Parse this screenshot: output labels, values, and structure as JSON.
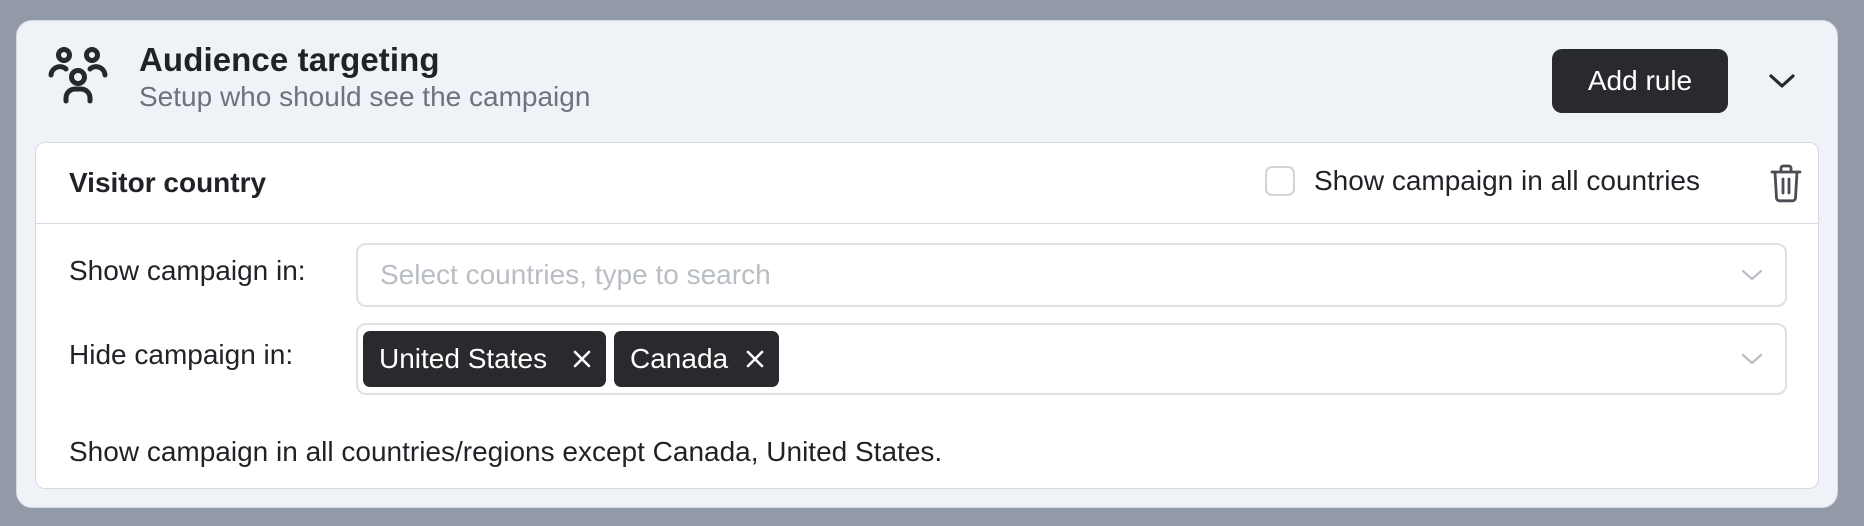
{
  "header": {
    "icon": "people-group-icon",
    "title": "Audience targeting",
    "subtitle": "Setup who should see the campaign",
    "add_rule_label": "Add rule",
    "collapse_icon": "chevron-down-icon"
  },
  "rule": {
    "title": "Visitor country",
    "all_countries": {
      "label": "Show campaign in all countries",
      "checked": false
    },
    "delete_icon": "trash-icon",
    "show_in": {
      "label": "Show campaign in:",
      "placeholder": "Select countries, type to search",
      "selected": []
    },
    "hide_in": {
      "label": "Hide campaign in:",
      "selected": [
        {
          "label": "United States"
        },
        {
          "label": "Canada"
        }
      ]
    },
    "summary": "Show campaign in all countries/regions except Canada, United States."
  },
  "colors": {
    "background": "#929aa8",
    "card": "#eff2f6",
    "panel": "#ffffff",
    "primary_button": "#292a2d",
    "chip": "#292a2d",
    "text": "#1f2226",
    "muted_text": "#6d737c",
    "placeholder": "#b9bec5"
  }
}
